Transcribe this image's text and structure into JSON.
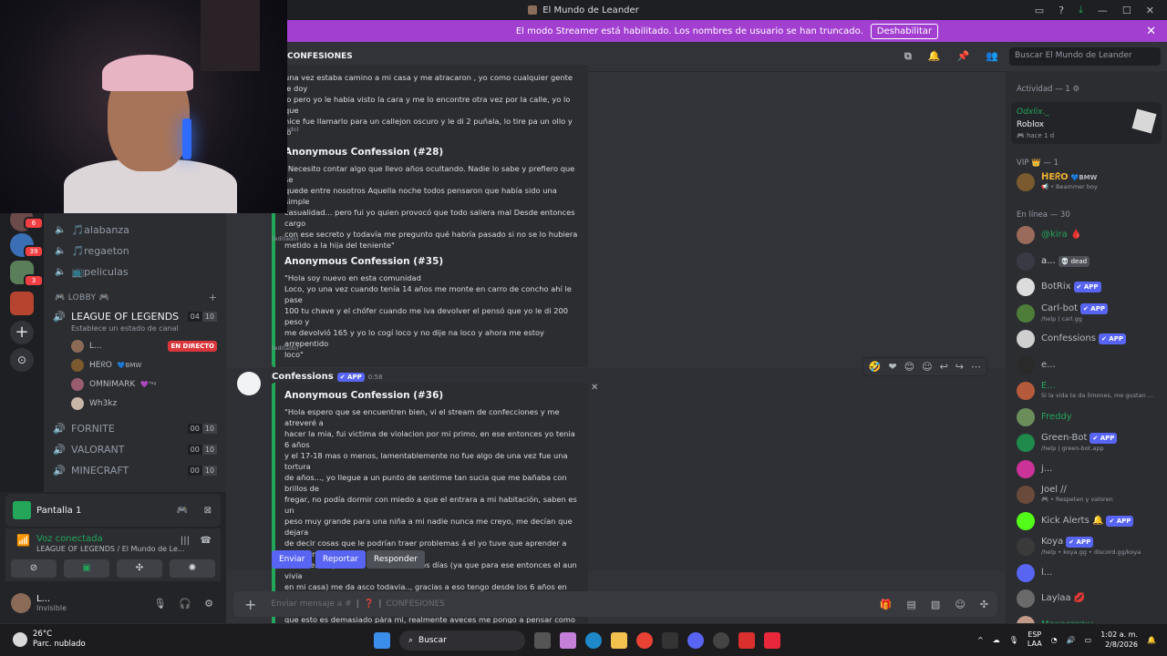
{
  "window": {
    "title": "El Mundo de Leander"
  },
  "banner": {
    "text": "El modo Streamer está habilitado. Los nombres de usuario se han truncado.",
    "button": "Deshabilitar"
  },
  "guilds": {
    "badges": [
      "6",
      "39",
      "3"
    ]
  },
  "channels": {
    "text_items": [
      {
        "label": "🎵alabanza"
      },
      {
        "label": "🎵regaeton"
      },
      {
        "label": "📺peliculas"
      }
    ],
    "category": "🎮 LOBBY 🎮",
    "voice": [
      {
        "name": "LEAGUE OF LEGENDS",
        "c1": "04",
        "c2": "10",
        "active": true
      },
      {
        "name": "FORNITE",
        "c1": "00",
        "c2": "10"
      },
      {
        "name": "VALORANT",
        "c1": "00",
        "c2": "10"
      },
      {
        "name": "MINECRAFT",
        "c1": "00",
        "c2": "10"
      }
    ],
    "voice_status": "Establece un estado de canal",
    "voice_users": [
      {
        "name": "L...",
        "live": "EN DIRECTO"
      },
      {
        "name": "ᕼEᖇO",
        "tag": "💙BMW"
      },
      {
        "name": "OMNIMARK",
        "tag": "💜ᵀᵃᵍ"
      },
      {
        "name": "Wh3kz"
      }
    ]
  },
  "panel": {
    "screen_label": "Pantalla 1",
    "voice_connected": "Voz conectada",
    "voice_location": "LEAGUE OF LEGENDS / El Mundo de Le...",
    "user_name": "L...",
    "user_status": "Invisible"
  },
  "chat": {
    "channel": "CONFESIONES",
    "search_placeholder": "Buscar El Mundo de Leander",
    "embeds": [
      {
        "title": "",
        "body": "una vez estaba camino a mi casa y me atracaron , yo como cualquier gente le doy\nlo pero yo le habia visto la cara y me lo encontre otra vez por la calle, yo lo que\nhice fue llamarlo para un callejon oscuro y le di 2 puñala, lo tire pa un ollo y lo\nenterre nunca encontran el tipo\"",
        "edited": "(editado)"
      },
      {
        "title": "Anonymous Confession (#28)",
        "body": "\"Necesito contar algo que llevo años ocultando. Nadie lo sabe y prefiero que se\nquede entre nosotros Aquella noche todos pensaron que había sido una simple\ncasualidad... pero fui yo quien provocó que todo saliera mal Desde entonces cargo\ncon ese secreto y todavía me pregunto qué habría pasado si no se lo hubiera\nmetido a la hija del teniente\"",
        "edited": "(editado)"
      },
      {
        "title": "Anonymous Confession (#35)",
        "body": "\"Hola soy nuevo en esta comunidad\nLoco, yo una vez cuando tenía 14 años me monte en carro de concho ahí le pase\n100 tu chave y el chófer cuando me iva devolver el pensó que yo le di 200 peso y\nme devolvió 165 y yo lo cogí loco y no dije na loco y ahora me estoy arrepentido\nloco\"",
        "edited": "(editado)"
      }
    ],
    "message": {
      "author": "Confessions",
      "app": "✔ APP",
      "time": "0:58",
      "embed_title": "Anonymous Confession (#36)",
      "embed_body": "\"Hola espero que se encuentren bien, vi el stream de confecciones y me atreveré a\nhacer la mia, fui victima de violacion por mi primo, en ese entonces yo tenia 6 años\ny el 17-18 mas o menos, lamentablemente no fue algo de una vez fue una tortura\nde años..., yo llegue a un punto de sentirme tan sucia que me bañaba con brillos de\nfregar, no podía dormir con miedo a que el entrara a mi habitación, saben es un\npeso muy grande para una niña a mi nadie nunca me creyo, me decían que dejara\nde decir cosas que le podrían traer problemas á el yo tuve que aprender a vivir con\neso a tener que verle la cara todos los días (ya que para ese entonces el aun vivia\nen mi casa) me da asco todavia.., gracias a eso tengo desde los 6 años en\ndepresión, aun no lo supero, me he intentalo suicidar muchas veces ya que siento\nque esto es demasiado pára mi, realmente aveces me pongo a pensar como\nalguien puede ser tan asqueroso pára hacerlo algo a una NIÑA.\"",
      "buttons": [
        "Enviar",
        "Reportar",
        "Responder"
      ]
    },
    "composer_placeholder": "Enviar mensaje a #  ❙ ❓ ❙  CONFESIONES"
  },
  "members": {
    "activity_header": "Actividad — 1 ⚙",
    "activity": {
      "user": "Odxlix._",
      "game": "Roblox",
      "time": "🎮 hace 1 d"
    },
    "vip_header": "VIP 👑 — 1",
    "vip": [
      {
        "name": "ᕼEᖇO",
        "tag": "💙BMW",
        "status": "📢 • Beammer boy"
      }
    ],
    "online_header": "En línea — 30",
    "online": [
      {
        "name": "@kira 🩸",
        "status": "",
        "app": false,
        "color": "#23a55a"
      },
      {
        "name": "a...",
        "status": "",
        "tag": "💀 dead",
        "app": false,
        "color": "#dbdee1"
      },
      {
        "name": "BotRix",
        "status": "",
        "app": true,
        "color": "#b5bac1"
      },
      {
        "name": "Carl-bot",
        "status": "/help | carl.gg",
        "app": true,
        "color": "#b5bac1"
      },
      {
        "name": "Confessions",
        "status": "",
        "app": true,
        "color": "#b5bac1"
      },
      {
        "name": "e...",
        "status": "",
        "app": false,
        "color": "#b5bac1"
      },
      {
        "name": "E...",
        "status": "Si la vida te da limones, me gustan ...",
        "app": false,
        "color": "#23a55a"
      },
      {
        "name": "Freddy",
        "status": "",
        "app": false,
        "color": "#23a55a"
      },
      {
        "name": "Green-Bot",
        "status": "/help | green-bot.app",
        "app": true,
        "color": "#b5bac1"
      },
      {
        "name": "j...",
        "status": "",
        "app": false,
        "color": "#b5bac1"
      },
      {
        "name": "Joel ∕∕",
        "status": "🎮 • Respeten y valoren",
        "app": false,
        "color": "#b5bac1"
      },
      {
        "name": "Kick Alerts 🔔",
        "status": "",
        "app": true,
        "color": "#b5bac1"
      },
      {
        "name": "Koya",
        "status": "/help • koya.gg • discord.gg/koya",
        "app": true,
        "color": "#b5bac1"
      },
      {
        "name": "l...",
        "status": "",
        "app": false,
        "color": "#b5bac1"
      },
      {
        "name": "Laylaa 💋",
        "status": "",
        "app": false,
        "color": "#b5bac1"
      },
      {
        "name": "Maxacrez:v",
        "status": "",
        "app": false,
        "color": "#23a55a"
      }
    ],
    "app_label": "✔ APP"
  },
  "taskbar": {
    "weather_temp": "26°C",
    "weather_desc": "Parc. nublado",
    "search": "Buscar",
    "lang1": "ESP",
    "lang2": "LAA",
    "time": "1:02 a. m.",
    "date": "2/8/2026"
  }
}
